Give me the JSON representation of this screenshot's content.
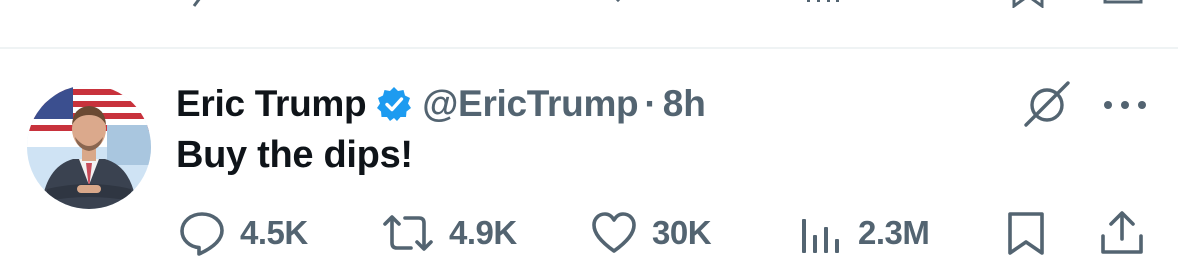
{
  "tweet": {
    "author_name": "Eric Trump",
    "handle": "@EricTrump",
    "separator": "·",
    "time": "8h",
    "text": "Buy the dips!",
    "verified": true,
    "accent": "#1d9bf0",
    "text_color": "#0f1419",
    "muted_color": "#536471"
  },
  "actions": {
    "replies": "4.5K",
    "reposts": "4.9K",
    "likes": "30K",
    "views": "2.3M"
  },
  "icons": {
    "grok": "grok-icon",
    "more": "more-icon",
    "reply": "reply-icon",
    "repost": "repost-icon",
    "like": "heart-icon",
    "views": "views-icon",
    "bookmark": "bookmark-icon",
    "share": "share-icon"
  }
}
